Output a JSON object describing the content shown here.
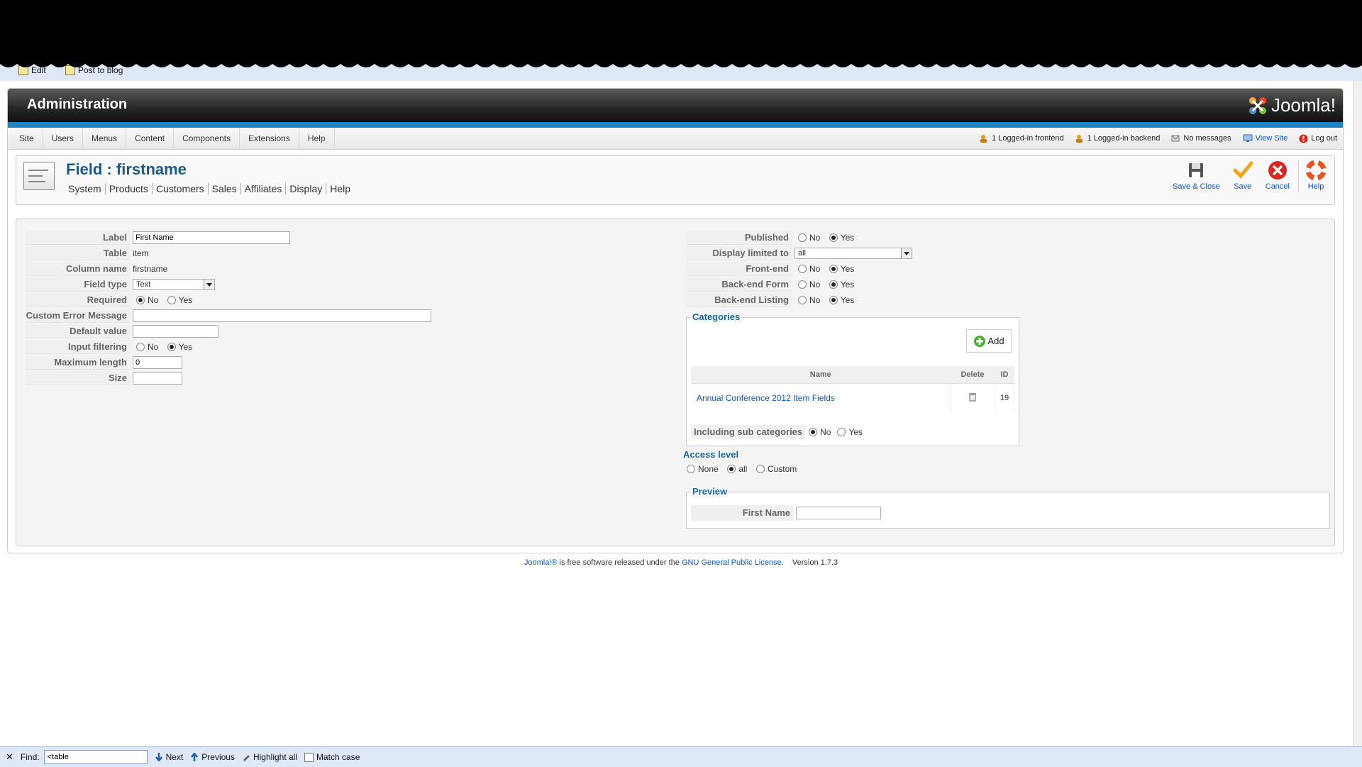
{
  "browser": {
    "bookmarks": [
      "Edit",
      "Post to blog"
    ]
  },
  "header": {
    "title": "Administration",
    "logo_text": "Joomla!"
  },
  "menu": [
    "Site",
    "Users",
    "Menus",
    "Content",
    "Components",
    "Extensions",
    "Help"
  ],
  "status": {
    "frontend": "1 Logged-in frontend",
    "backend": "1 Logged-in backend",
    "messages": "No messages",
    "view_site": "View Site",
    "logout": "Log out"
  },
  "page": {
    "title": "Field : firstname",
    "submenu": [
      "System",
      "Products",
      "Customers",
      "Sales",
      "Affiliates",
      "Display",
      "Help"
    ]
  },
  "toolbar": {
    "save_close": "Save & Close",
    "save": "Save",
    "cancel": "Cancel",
    "help": "Help"
  },
  "left_form": {
    "label_key": "Label",
    "label_value": "First Name",
    "table_key": "Table",
    "table_value": "item",
    "column_key": "Column name",
    "column_value": "firstname",
    "type_key": "Field type",
    "type_value": "Text",
    "required_key": "Required",
    "required_no": "No",
    "required_yes": "Yes",
    "error_key": "Custom Error Message",
    "error_value": "",
    "default_key": "Default value",
    "default_value": "",
    "filter_key": "Input filtering",
    "filter_no": "No",
    "filter_yes": "Yes",
    "maxlen_key": "Maximum length",
    "maxlen_value": "0",
    "size_key": "Size",
    "size_value": ""
  },
  "right_form": {
    "published_key": "Published",
    "display_key": "Display limited to",
    "display_value": "all",
    "frontend_key": "Front-end",
    "backform_key": "Back-end Form",
    "backlist_key": "Back-end Listing",
    "no": "No",
    "yes": "Yes"
  },
  "categories": {
    "legend": "Categories",
    "add": "Add",
    "col_name": "Name",
    "col_delete": "Delete",
    "col_id": "ID",
    "row_name": "Annual Conference 2012 Item Fields",
    "row_id": "19",
    "include_sub_key": "Including sub categories",
    "include_no": "No",
    "include_yes": "Yes"
  },
  "access": {
    "title": "Access level",
    "none": "None",
    "all": "all",
    "custom": "Custom"
  },
  "preview": {
    "legend": "Preview",
    "field_label": "First Name"
  },
  "footer": {
    "joomla": "Joomla!®",
    "text1": " is free software released under the ",
    "license": "GNU General Public License",
    "text2": ".",
    "version": "Version 1.7.3"
  },
  "findbar": {
    "find_label": "Find:",
    "query": "<table",
    "next": "Next",
    "previous": "Previous",
    "highlight": "Highlight all",
    "match_case": "Match case"
  }
}
